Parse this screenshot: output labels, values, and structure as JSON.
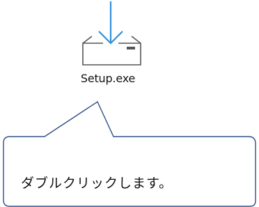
{
  "desktop": {
    "file": {
      "name": "Setup.exe",
      "icon": "installer-download-icon",
      "accent_color": "#2f8fd8",
      "outline_color": "#555555"
    }
  },
  "callout": {
    "text": "ダブルクリックします。",
    "border_color": "#2f4f86"
  }
}
